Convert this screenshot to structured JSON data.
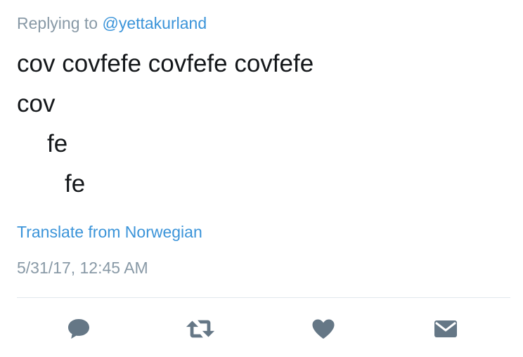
{
  "reply_context": {
    "prefix": "Replying to",
    "handle": "@yettakurland"
  },
  "tweet": {
    "lines": [
      "cov covfefe covfefe covfefe",
      "cov",
      "fe",
      "fe"
    ],
    "translate_label": "Translate from Norwegian",
    "timestamp": "5/31/17, 12:45 AM"
  },
  "actions": [
    {
      "icon": "reply-icon"
    },
    {
      "icon": "retweet-icon"
    },
    {
      "icon": "like-icon"
    },
    {
      "icon": "direct-message-icon"
    }
  ],
  "colors": {
    "text": "#14171a",
    "muted": "#8899a6",
    "link": "#3b94d9",
    "icon": "#657786",
    "divider": "#e1e8ed"
  }
}
